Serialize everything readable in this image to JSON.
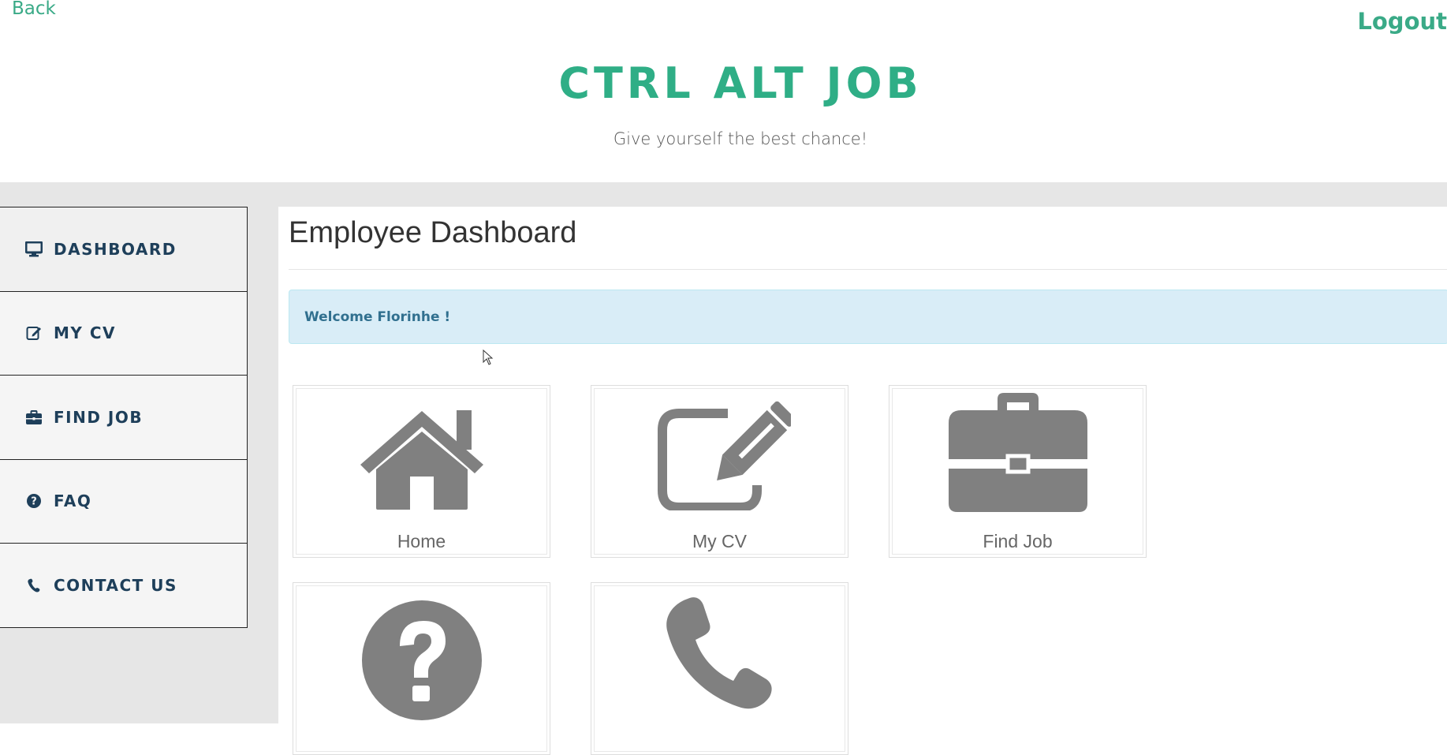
{
  "header": {
    "back_label": "Back",
    "logout_label": "Logout",
    "site_title": "CTRL ALT JOB",
    "tagline": "Give yourself the best chance!"
  },
  "sidebar": {
    "items": [
      {
        "label": "DASHBOARD",
        "icon": "desktop-icon"
      },
      {
        "label": "MY CV",
        "icon": "edit-icon"
      },
      {
        "label": "FIND JOB",
        "icon": "briefcase-icon"
      },
      {
        "label": "FAQ",
        "icon": "question-circle-icon"
      },
      {
        "label": "CONTACT US",
        "icon": "phone-icon"
      }
    ]
  },
  "main": {
    "page_title": "Employee Dashboard",
    "welcome_message": "Welcome Florinhe !",
    "tiles": [
      {
        "label": "Home",
        "icon": "home-icon"
      },
      {
        "label": "My CV",
        "icon": "edit-icon"
      },
      {
        "label": "Find Job",
        "icon": "briefcase-icon"
      },
      {
        "label": "",
        "icon": "question-circle-icon"
      },
      {
        "label": "",
        "icon": "phone-icon"
      }
    ]
  },
  "colors": {
    "brand_green": "#2fae86",
    "sidebar_text": "#1e3f5a",
    "alert_bg": "#d9edf7",
    "alert_text": "#31708f",
    "tile_icon": "#808080",
    "page_bg": "#e6e6e6"
  }
}
